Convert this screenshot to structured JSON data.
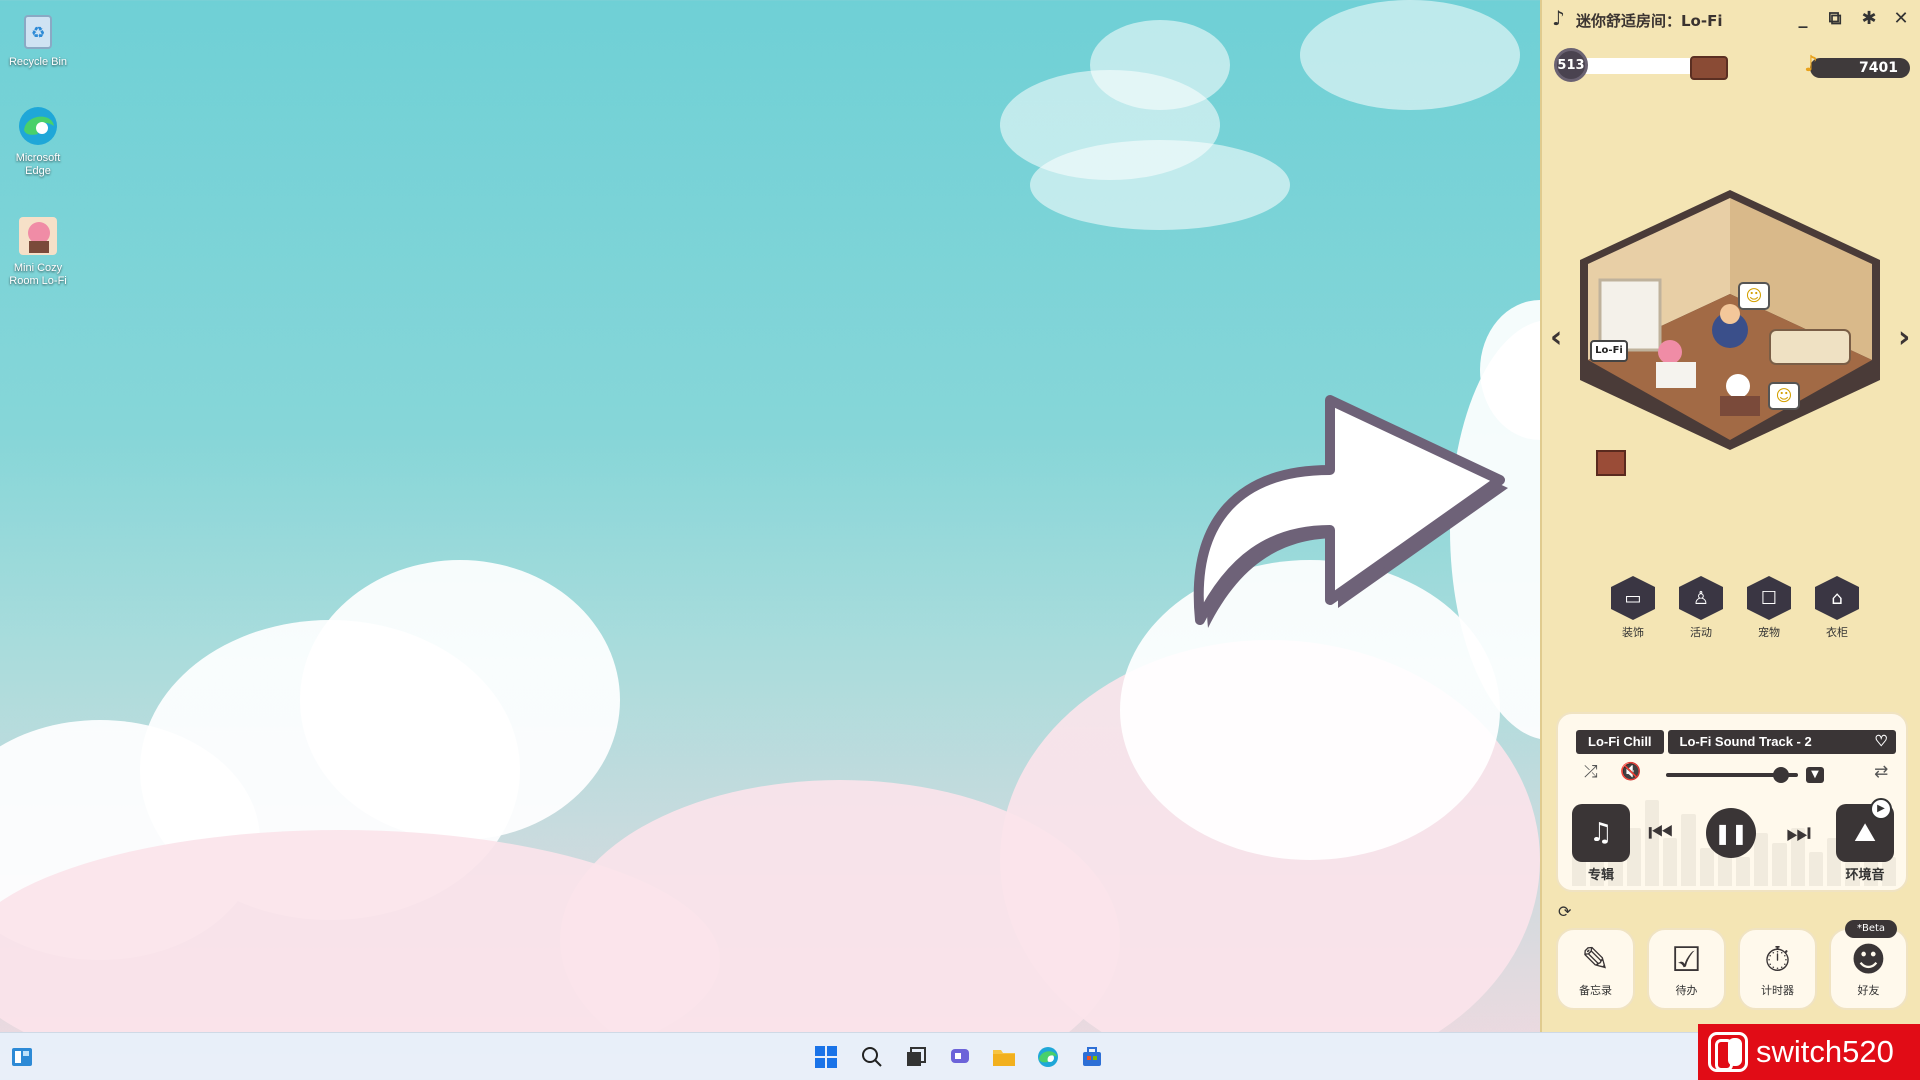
{
  "desktop": {
    "icons": [
      {
        "label": "Recycle Bin",
        "icon": "recycle-bin-icon"
      },
      {
        "label": "Microsoft Edge",
        "icon": "edge-icon"
      },
      {
        "label": "Mini Cozy Room Lo-Fi",
        "icon": "mini-cozy-room-icon"
      }
    ]
  },
  "app": {
    "title": "迷你舒适房间：Lo-Fi",
    "level": "513",
    "coins": "7401",
    "room_bubble": "Lo-Fi",
    "categories": [
      {
        "label": "装饰",
        "icon": "sofa-icon"
      },
      {
        "label": "活动",
        "icon": "lamp-icon"
      },
      {
        "label": "宠物",
        "icon": "pet-icon"
      },
      {
        "label": "衣柜",
        "icon": "hanger-icon"
      }
    ],
    "player": {
      "playlist": "Lo-Fi Chill",
      "track": "Lo-Fi Sound Track - 2",
      "volume": 0.92,
      "album_label": "专辑",
      "ambient_label": "环境音"
    },
    "tools": [
      {
        "label": "备忘录",
        "icon": "memo-icon"
      },
      {
        "label": "待办",
        "icon": "todo-icon"
      },
      {
        "label": "计时器",
        "icon": "timer-icon"
      },
      {
        "label": "好友",
        "icon": "friends-icon"
      }
    ],
    "beta_badge": "*Beta"
  },
  "watermark": {
    "text": "switch520"
  },
  "colors": {
    "panel_bg": "#f4e5b4",
    "dark": "#3a3536",
    "brand_red": "#e10c16"
  }
}
